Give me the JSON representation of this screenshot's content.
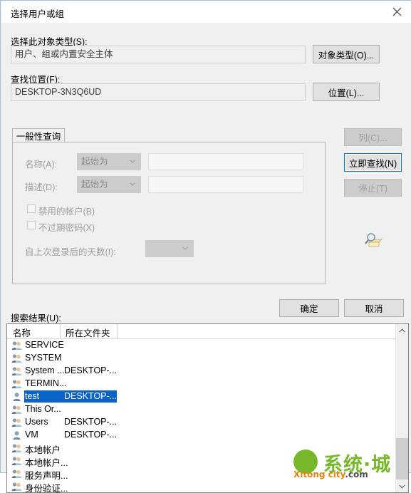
{
  "window": {
    "title": "选择用户或组",
    "close_icon": "close-icon"
  },
  "object_type": {
    "label": "选择此对象类型(S):",
    "value": "用户、组或内置安全主体",
    "button": "对象类型(O)..."
  },
  "location": {
    "label": "查找位置(F):",
    "value": "DESKTOP-3N3Q6UD",
    "button": "位置(L)..."
  },
  "query": {
    "tab_label": "一般性查询",
    "name": {
      "label": "名称(A):",
      "condition": "起始为",
      "value": ""
    },
    "description": {
      "label": "描述(D):",
      "condition": "起始为",
      "value": ""
    },
    "disabled_accounts": {
      "label": "禁用的帐户(B)",
      "checked": false
    },
    "non_expiring_password": {
      "label": "不过期密码(X)",
      "checked": false
    },
    "days_since_logon": {
      "label": "自上次登录后的天数(I):",
      "value": ""
    }
  },
  "side_buttons": {
    "columns": "列(C)...",
    "find_now": "立即查找(N)",
    "stop": "停止(T)",
    "search_icon": "magnifier-folder-icon"
  },
  "footer": {
    "ok": "确定",
    "cancel": "取消"
  },
  "results": {
    "label": "搜索结果(U):",
    "columns": [
      "名称",
      "所在文件夹"
    ],
    "rows": [
      {
        "icon": "group-icon",
        "name": "SERVICE",
        "folder": "",
        "selected": false
      },
      {
        "icon": "group-icon",
        "name": "SYSTEM",
        "folder": "",
        "selected": false
      },
      {
        "icon": "group-icon",
        "name": "System ...",
        "folder": "DESKTOP-...",
        "selected": false
      },
      {
        "icon": "group-icon",
        "name": "TERMIN...",
        "folder": "",
        "selected": false
      },
      {
        "icon": "user-icon",
        "name": "test",
        "folder": "DESKTOP-...",
        "selected": true
      },
      {
        "icon": "group-icon",
        "name": "This Or...",
        "folder": "",
        "selected": false
      },
      {
        "icon": "group-icon",
        "name": "Users",
        "folder": "DESKTOP-...",
        "selected": false
      },
      {
        "icon": "user-icon",
        "name": "VM",
        "folder": "DESKTOP-...",
        "selected": false
      },
      {
        "icon": "group-icon",
        "name": "本地帐户",
        "folder": "",
        "selected": false
      },
      {
        "icon": "group-icon",
        "name": "本地帐户...",
        "folder": "",
        "selected": false
      },
      {
        "icon": "group-icon",
        "name": "服务声明...",
        "folder": "",
        "selected": false
      },
      {
        "icon": "group-icon",
        "name": "身份验证...",
        "folder": "",
        "selected": false
      }
    ],
    "scrollbar": {
      "up_icon": "chevron-up-icon",
      "down_icon": "chevron-down-icon"
    }
  },
  "watermark": {
    "main": "系统·城",
    "sub_brand": "Xitong city",
    "sub_domain": ".com"
  },
  "colors": {
    "accent": "#0078d7",
    "selection": "#0a64c8",
    "dialog_bg": "#f0f0f0",
    "watermark_green": "#76b82a",
    "watermark_orange": "#e8820c"
  }
}
